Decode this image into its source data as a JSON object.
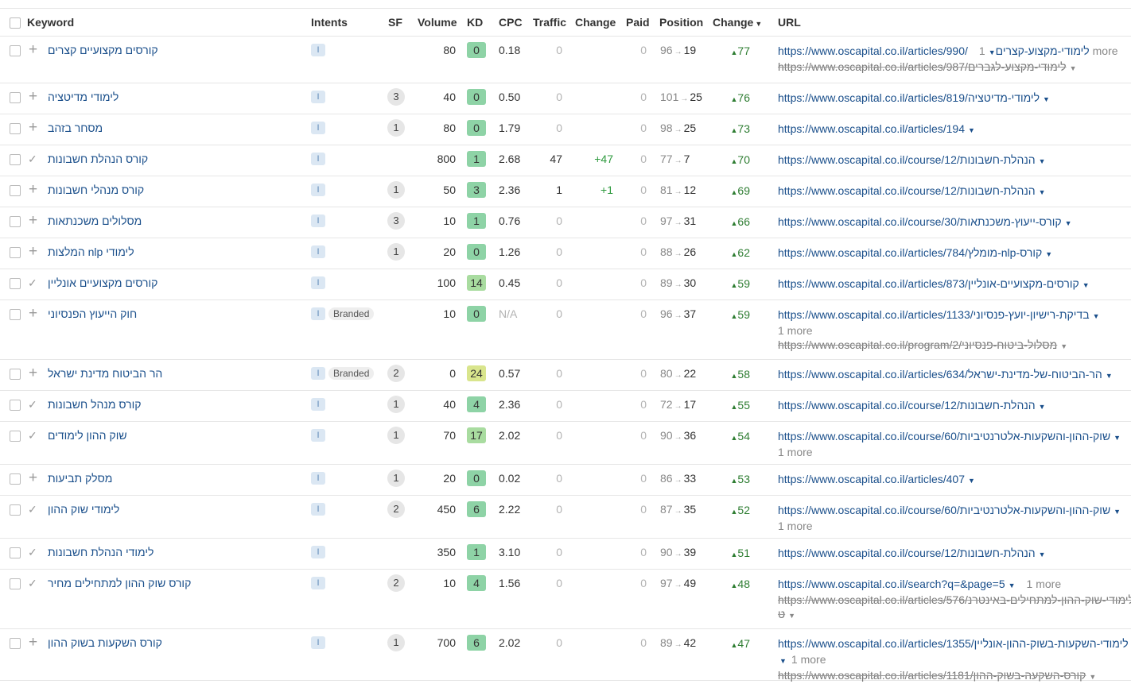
{
  "headers": {
    "keyword": "Keyword",
    "intents": "Intents",
    "sf": "SF",
    "volume": "Volume",
    "kd": "KD",
    "cpc": "CPC",
    "traffic": "Traffic",
    "change": "Change",
    "paid": "Paid",
    "position": "Position",
    "change2": "Change",
    "url": "URL"
  },
  "kd_colors": {
    "0": "#8ed3a6",
    "1": "#8ed3a6",
    "3": "#8ed3a6",
    "4": "#8ed3a6",
    "6": "#8ed3a6",
    "14": "#a9dca0",
    "17": "#a9dca0",
    "24": "#d9e58d"
  },
  "rows": [
    {
      "keyword": "קורסים מקצועיים קצרים",
      "action": "plus",
      "intent": "I",
      "branded": "",
      "sf": "",
      "volume": "80",
      "kd": "0",
      "cpc": "0.18",
      "traffic": "0",
      "change": "",
      "paid": "0",
      "pos_from": "96",
      "pos_to": "19",
      "chg": "77",
      "url": "https://www.oscapital.co.il/articles/990/לימודי-מקצוע-קצרים",
      "more": "1 more",
      "url2": "https://www.oscapital.co.il/articles/987/לימודי-מקצוע-לגברים",
      "url2b": ""
    },
    {
      "keyword": "לימודי מדיטציה",
      "action": "plus",
      "intent": "I",
      "branded": "",
      "sf": "3",
      "volume": "40",
      "kd": "0",
      "cpc": "0.50",
      "traffic": "0",
      "change": "",
      "paid": "0",
      "pos_from": "101",
      "pos_to": "25",
      "chg": "76",
      "url": "https://www.oscapital.co.il/articles/819/לימודי-מדיטציה",
      "more": "",
      "url2": "",
      "url2b": ""
    },
    {
      "keyword": "מסחר בזהב",
      "action": "plus",
      "intent": "I",
      "branded": "",
      "sf": "1",
      "volume": "80",
      "kd": "0",
      "cpc": "1.79",
      "traffic": "0",
      "change": "",
      "paid": "0",
      "pos_from": "98",
      "pos_to": "25",
      "chg": "73",
      "url": "https://www.oscapital.co.il/articles/194",
      "more": "",
      "url2": "",
      "url2b": ""
    },
    {
      "keyword": "קורס הנהלת חשבונות",
      "action": "check",
      "intent": "I",
      "branded": "",
      "sf": "",
      "volume": "800",
      "kd": "1",
      "cpc": "2.68",
      "traffic": "47",
      "change": "+47",
      "paid": "0",
      "pos_from": "77",
      "pos_to": "7",
      "chg": "70",
      "url": "https://www.oscapital.co.il/course/12/הנהלת-חשבונות",
      "more": "",
      "url2": "",
      "url2b": ""
    },
    {
      "keyword": "קורס מנהלי חשבונות",
      "action": "plus",
      "intent": "I",
      "branded": "",
      "sf": "1",
      "volume": "50",
      "kd": "3",
      "cpc": "2.36",
      "traffic": "1",
      "change": "+1",
      "paid": "0",
      "pos_from": "81",
      "pos_to": "12",
      "chg": "69",
      "url": "https://www.oscapital.co.il/course/12/הנהלת-חשבונות",
      "more": "",
      "url2": "",
      "url2b": ""
    },
    {
      "keyword": "מסלולים משכנתאות",
      "action": "plus",
      "intent": "I",
      "branded": "",
      "sf": "3",
      "volume": "10",
      "kd": "1",
      "cpc": "0.76",
      "traffic": "0",
      "change": "",
      "paid": "0",
      "pos_from": "97",
      "pos_to": "31",
      "chg": "66",
      "url": "https://www.oscapital.co.il/course/30/קורס-ייעוץ-משכנתאות",
      "more": "",
      "url2": "",
      "url2b": ""
    },
    {
      "keyword": "המלצות nlp לימודי",
      "action": "plus",
      "intent": "I",
      "branded": "",
      "sf": "1",
      "volume": "20",
      "kd": "0",
      "cpc": "1.26",
      "traffic": "0",
      "change": "",
      "paid": "0",
      "pos_from": "88",
      "pos_to": "26",
      "chg": "62",
      "url": "https://www.oscapital.co.il/articles/784/מומלץ-nlp-קורס",
      "more": "",
      "url2": "",
      "url2b": ""
    },
    {
      "keyword": "קורסים מקצועיים אונליין",
      "action": "check",
      "intent": "I",
      "branded": "",
      "sf": "",
      "volume": "100",
      "kd": "14",
      "cpc": "0.45",
      "traffic": "0",
      "change": "",
      "paid": "0",
      "pos_from": "89",
      "pos_to": "30",
      "chg": "59",
      "url": "https://www.oscapital.co.il/articles/873/קורסים-מקצועיים-אונליין",
      "more": "",
      "url2": "",
      "url2b": ""
    },
    {
      "keyword": "חוק הייעוץ הפנסיוני",
      "action": "plus",
      "intent": "I",
      "branded": "Branded",
      "sf": "",
      "volume": "10",
      "kd": "0",
      "cpc": "N/A",
      "traffic": "0",
      "change": "",
      "paid": "0",
      "pos_from": "96",
      "pos_to": "37",
      "chg": "59",
      "url": "https://www.oscapital.co.il/articles/1133/בדיקת-רישיון-יועץ-פנסיוני",
      "more": "1 more",
      "url2": "https://www.oscapital.co.il/program/2/מסלול-ביטוח-פנסיוני",
      "url2b": ""
    },
    {
      "keyword": "הר הביטוח מדינת ישראל",
      "action": "plus",
      "intent": "I",
      "branded": "Branded",
      "sf": "2",
      "volume": "0",
      "kd": "24",
      "cpc": "0.57",
      "traffic": "0",
      "change": "",
      "paid": "0",
      "pos_from": "80",
      "pos_to": "22",
      "chg": "58",
      "url": "https://www.oscapital.co.il/articles/634/הר-הביטוח-של-מדינת-ישראל",
      "more": "",
      "url2": "",
      "url2b": ""
    },
    {
      "keyword": "קורס מנהל חשבונות",
      "action": "check",
      "intent": "I",
      "branded": "",
      "sf": "1",
      "volume": "40",
      "kd": "4",
      "cpc": "2.36",
      "traffic": "0",
      "change": "",
      "paid": "0",
      "pos_from": "72",
      "pos_to": "17",
      "chg": "55",
      "url": "https://www.oscapital.co.il/course/12/הנהלת-חשבונות",
      "more": "",
      "url2": "",
      "url2b": ""
    },
    {
      "keyword": "שוק ההון לימודים",
      "action": "check",
      "intent": "I",
      "branded": "",
      "sf": "1",
      "volume": "70",
      "kd": "17",
      "cpc": "2.02",
      "traffic": "0",
      "change": "",
      "paid": "0",
      "pos_from": "90",
      "pos_to": "36",
      "chg": "54",
      "url": "https://www.oscapital.co.il/course/60/שוק-ההון-והשקעות-אלטרנטיביות",
      "more": "1 more",
      "url2": "",
      "url2b": ""
    },
    {
      "keyword": "מסלק תביעות",
      "action": "plus",
      "intent": "I",
      "branded": "",
      "sf": "1",
      "volume": "20",
      "kd": "0",
      "cpc": "0.02",
      "traffic": "0",
      "change": "",
      "paid": "0",
      "pos_from": "86",
      "pos_to": "33",
      "chg": "53",
      "url": "https://www.oscapital.co.il/articles/407",
      "more": "",
      "url2": "",
      "url2b": ""
    },
    {
      "keyword": "לימודי שוק ההון",
      "action": "check",
      "intent": "I",
      "branded": "",
      "sf": "2",
      "volume": "450",
      "kd": "6",
      "cpc": "2.22",
      "traffic": "0",
      "change": "",
      "paid": "0",
      "pos_from": "87",
      "pos_to": "35",
      "chg": "52",
      "url": "https://www.oscapital.co.il/course/60/שוק-ההון-והשקעות-אלטרנטיביות",
      "more": "1 more",
      "url2": "",
      "url2b": ""
    },
    {
      "keyword": "לימודי הנהלת חשבונות",
      "action": "check",
      "intent": "I",
      "branded": "",
      "sf": "",
      "volume": "350",
      "kd": "1",
      "cpc": "3.10",
      "traffic": "0",
      "change": "",
      "paid": "0",
      "pos_from": "90",
      "pos_to": "39",
      "chg": "51",
      "url": "https://www.oscapital.co.il/course/12/הנהלת-חשבונות",
      "more": "",
      "url2": "",
      "url2b": ""
    },
    {
      "keyword": "קורס שוק ההון למתחילים מחיר",
      "action": "check",
      "intent": "I",
      "branded": "",
      "sf": "2",
      "volume": "10",
      "kd": "4",
      "cpc": "1.56",
      "traffic": "0",
      "change": "",
      "paid": "0",
      "pos_from": "97",
      "pos_to": "49",
      "chg": "48",
      "url": "https://www.oscapital.co.il/search?q=&page=5",
      "more": "1 more",
      "url2": "https://www.oscapital.co.il/articles/576/לימודי-שוק-ההון-למתחילים-באינטרנ",
      "url2b": "ט"
    },
    {
      "keyword": "קורס השקעות בשוק ההון",
      "action": "plus",
      "intent": "I",
      "branded": "",
      "sf": "1",
      "volume": "700",
      "kd": "6",
      "cpc": "2.02",
      "traffic": "0",
      "change": "",
      "paid": "0",
      "pos_from": "89",
      "pos_to": "42",
      "chg": "47",
      "url": "https://www.oscapital.co.il/articles/1355/לימודי-השקעות-בשוק-ההון-אונליין",
      "more": "1 more",
      "url2": "https://www.oscapital.co.il/articles/1181/קורס-השקעה-בשוק-ההון",
      "url2b": ""
    }
  ]
}
